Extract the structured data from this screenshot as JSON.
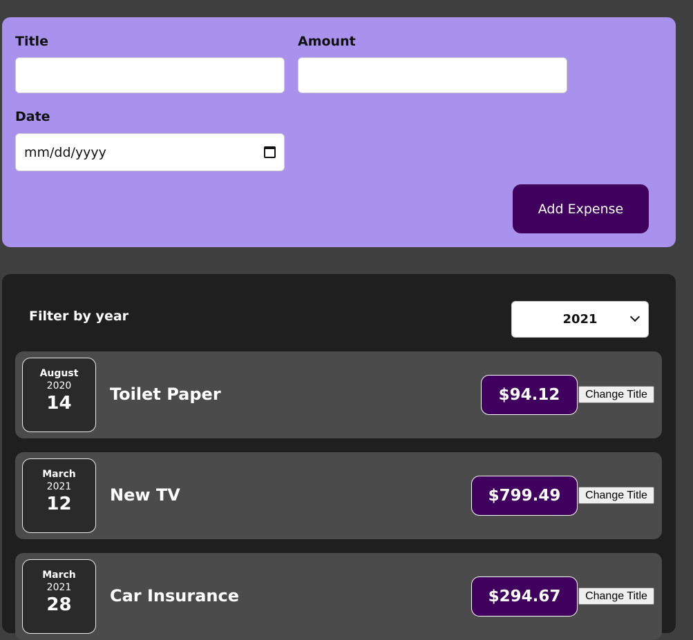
{
  "form": {
    "title_label": "Title",
    "amount_label": "Amount",
    "date_label": "Date",
    "title_value": "",
    "amount_value": "",
    "date_placeholder": "mm/dd/yyyy",
    "date_icon": "calendar-icon",
    "submit_label": "Add Expense"
  },
  "filter": {
    "label": "Filter by year",
    "selected_year": "2021"
  },
  "expenses": [
    {
      "month": "August",
      "year": "2020",
      "day": "14",
      "title": "Toilet Paper",
      "amount": "$94.12",
      "action": "Change Title"
    },
    {
      "month": "March",
      "year": "2021",
      "day": "12",
      "title": "New TV",
      "amount": "$799.49",
      "action": "Change Title"
    },
    {
      "month": "March",
      "year": "2021",
      "day": "28",
      "title": "Car Insurance",
      "amount": "$294.67",
      "action": "Change Title"
    }
  ],
  "colors": {
    "form_bg": "#a892ee",
    "accent": "#40005d",
    "list_bg": "#1f1f1f",
    "item_bg": "#4b4b4b"
  }
}
